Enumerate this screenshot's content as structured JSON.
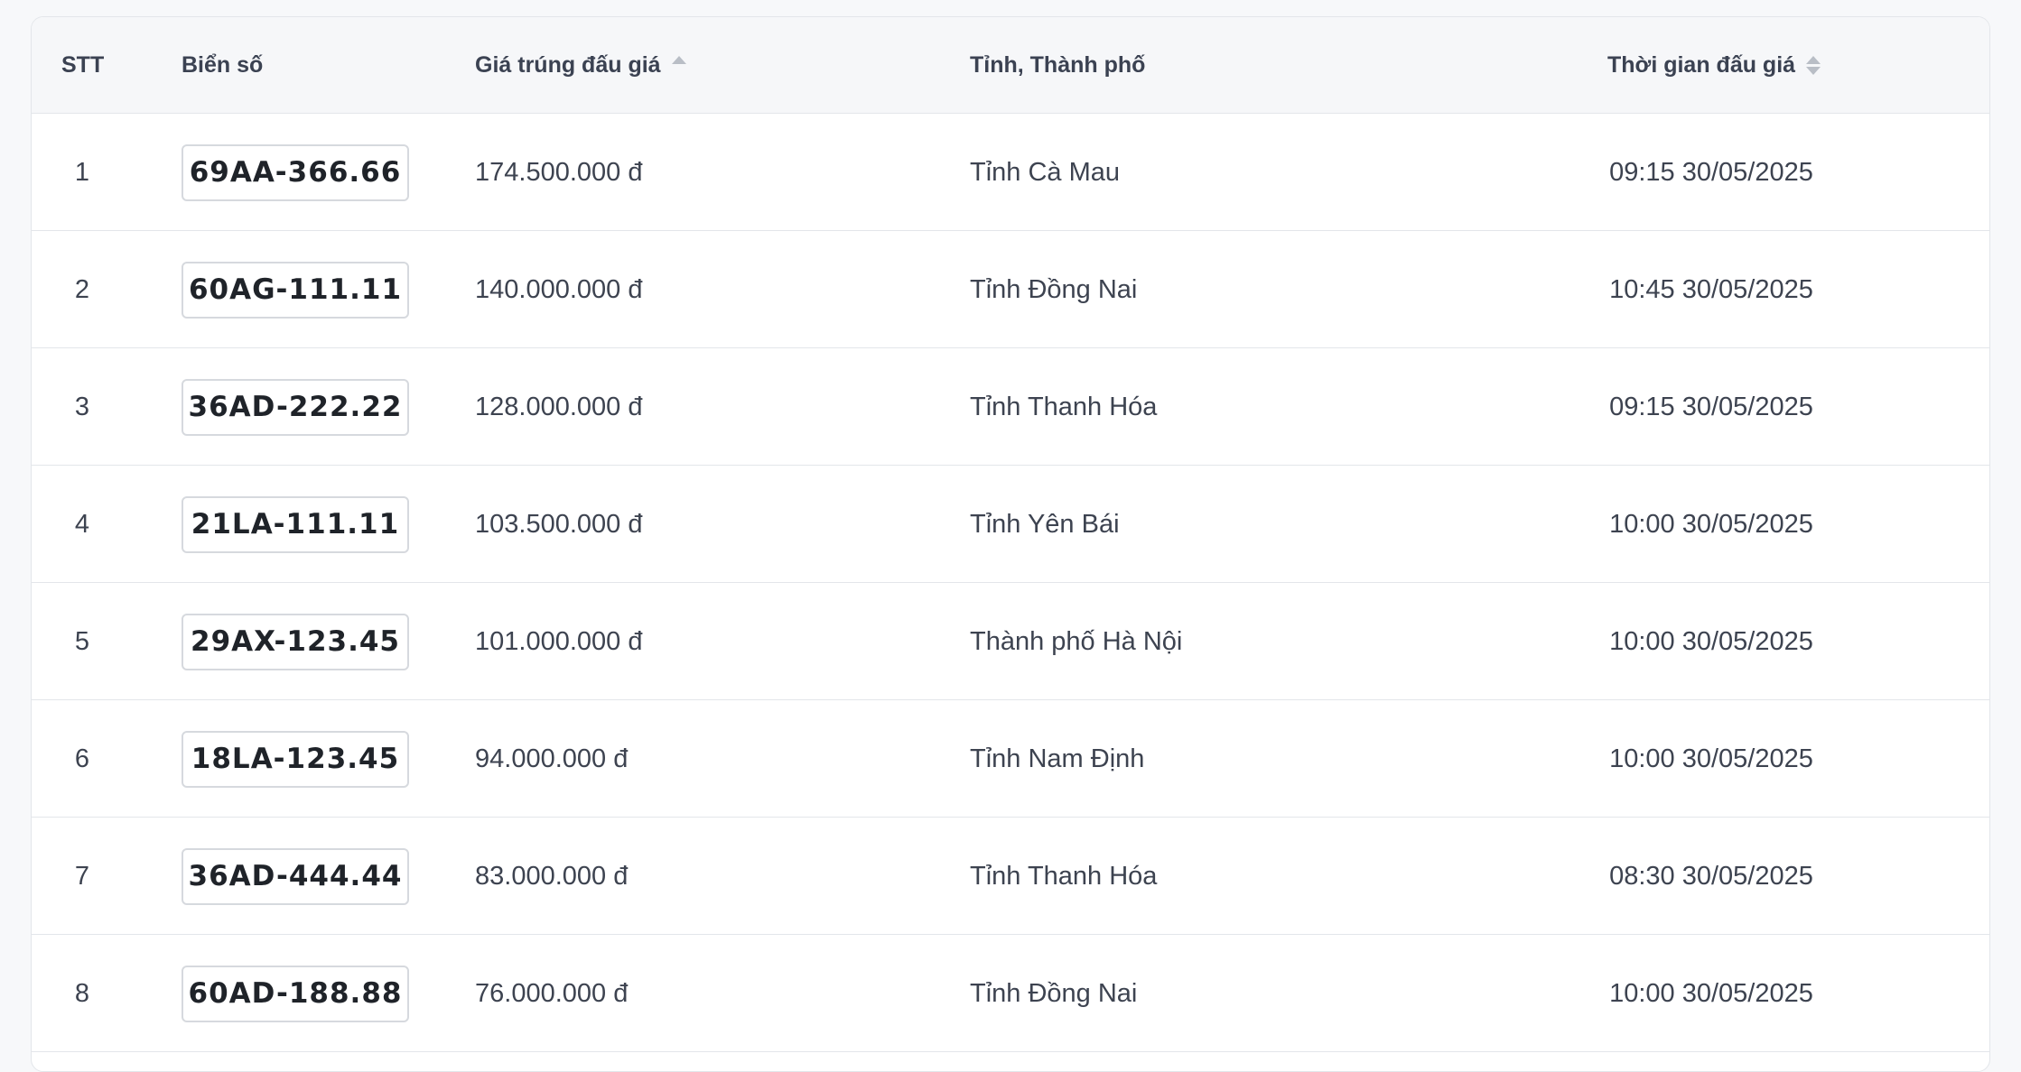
{
  "table": {
    "headers": {
      "stt": "STT",
      "plate": "Biển số",
      "price": "Giá trúng đấu giá",
      "province": "Tỉnh, Thành phố",
      "time": "Thời gian đấu giá"
    },
    "rows": [
      {
        "stt": "1",
        "plate": "69AA-366.66",
        "price": "174.500.000 đ",
        "province": "Tỉnh Cà Mau",
        "time": "09:15 30/05/2025"
      },
      {
        "stt": "2",
        "plate": "60AG-111.11",
        "price": "140.000.000 đ",
        "province": "Tỉnh Đồng Nai",
        "time": "10:45 30/05/2025"
      },
      {
        "stt": "3",
        "plate": "36AD-222.22",
        "price": "128.000.000 đ",
        "province": "Tỉnh Thanh Hóa",
        "time": "09:15 30/05/2025"
      },
      {
        "stt": "4",
        "plate": "21LA-111.11",
        "price": "103.500.000 đ",
        "province": "Tỉnh Yên Bái",
        "time": "10:00 30/05/2025"
      },
      {
        "stt": "5",
        "plate": "29AX-123.45",
        "price": "101.000.000 đ",
        "province": "Thành phố Hà Nội",
        "time": "10:00 30/05/2025"
      },
      {
        "stt": "6",
        "plate": "18LA-123.45",
        "price": "94.000.000 đ",
        "province": "Tỉnh Nam Định",
        "time": "10:00 30/05/2025"
      },
      {
        "stt": "7",
        "plate": "36AD-444.44",
        "price": "83.000.000 đ",
        "province": "Tỉnh Thanh Hóa",
        "time": "08:30 30/05/2025"
      },
      {
        "stt": "8",
        "plate": "60AD-188.88",
        "price": "76.000.000 đ",
        "province": "Tỉnh Đồng Nai",
        "time": "10:00 30/05/2025"
      }
    ]
  },
  "icons": {
    "price_sort": "sort-ascending-icon",
    "time_sort": "sort-icon"
  },
  "colors": {
    "header_bg": "#f6f7f9",
    "border": "#e3e6ea",
    "text": "#3d4350",
    "plate_text": "#1f2329"
  }
}
